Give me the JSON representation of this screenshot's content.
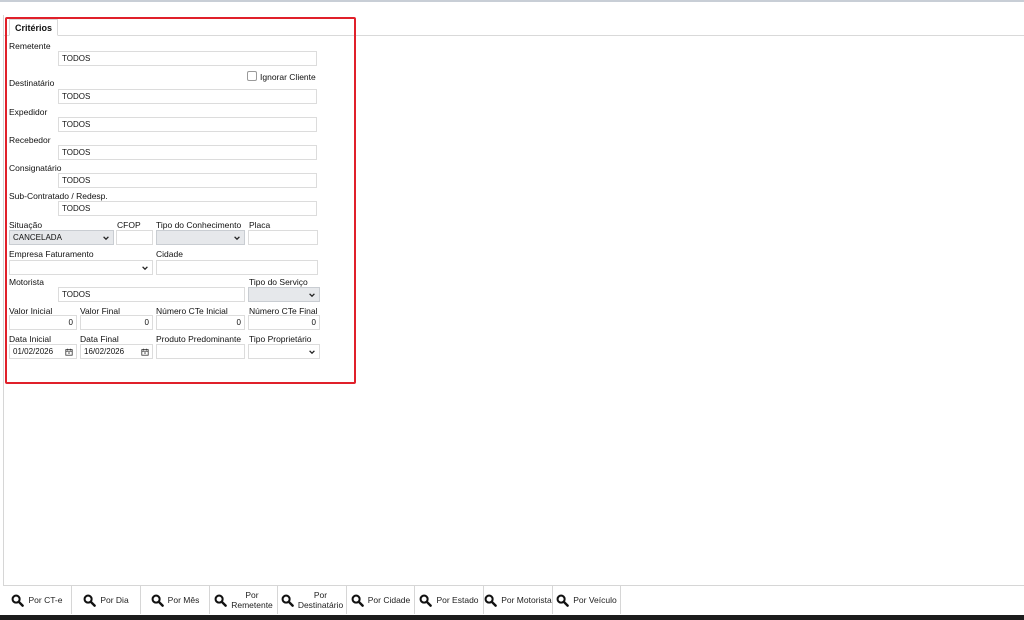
{
  "tab": {
    "label": "Critérios"
  },
  "fields": {
    "remetente": {
      "label": "Remetente",
      "value": "TODOS"
    },
    "ignorar_cliente": {
      "label": "Ignorar Cliente"
    },
    "destinatario": {
      "label": "Destinatário",
      "value": "TODOS"
    },
    "expedidor": {
      "label": "Expedidor",
      "value": "TODOS"
    },
    "recebedor": {
      "label": "Recebedor",
      "value": "TODOS"
    },
    "consignatario": {
      "label": "Consignatário",
      "value": "TODOS"
    },
    "subcontratado": {
      "label": "Sub-Contratado / Redesp.",
      "value": "TODOS"
    },
    "situacao": {
      "label": "Situação",
      "value": "CANCELADA"
    },
    "cfop": {
      "label": "CFOP",
      "value": ""
    },
    "tipo_conhecimento": {
      "label": "Tipo do Conhecimento",
      "value": ""
    },
    "placa": {
      "label": "Placa",
      "value": ""
    },
    "empresa_faturamento": {
      "label": "Empresa Faturamento",
      "value": ""
    },
    "cidade": {
      "label": "Cidade",
      "value": ""
    },
    "motorista": {
      "label": "Motorista",
      "value": "TODOS"
    },
    "tipo_servico": {
      "label": "Tipo do Serviço",
      "value": ""
    },
    "valor_inicial": {
      "label": "Valor Inicial",
      "value": "0"
    },
    "valor_final": {
      "label": "Valor Final",
      "value": "0"
    },
    "numero_cte_inicial": {
      "label": "Número CTe Inicial",
      "value": "0"
    },
    "numero_cte_final": {
      "label": "Número CTe Final",
      "value": "0"
    },
    "data_inicial": {
      "label": "Data Inicial",
      "value": "01/02/2026"
    },
    "data_final": {
      "label": "Data Final",
      "value": "16/02/2026"
    },
    "produto_predominante": {
      "label": "Produto Predominante",
      "value": ""
    },
    "tipo_proprietario": {
      "label": "Tipo Proprietário",
      "value": ""
    }
  },
  "buttons": [
    {
      "label": "Por CT-e"
    },
    {
      "label": "Por Dia"
    },
    {
      "label": "Por Mês"
    },
    {
      "line1": "Por",
      "line2": "Remetente"
    },
    {
      "line1": "Por",
      "line2": "Destinatário"
    },
    {
      "label": "Por Cidade"
    },
    {
      "label": "Por Estado"
    },
    {
      "label": "Por Motorista"
    },
    {
      "label": "Por Veículo"
    }
  ],
  "icons": {
    "button_icon": "search-icon",
    "dropdown": "chevron-down-icon",
    "date": "calendar-icon"
  },
  "colors": {
    "highlight_border": "#e0202a",
    "select_bg": "#e6e8eb"
  }
}
